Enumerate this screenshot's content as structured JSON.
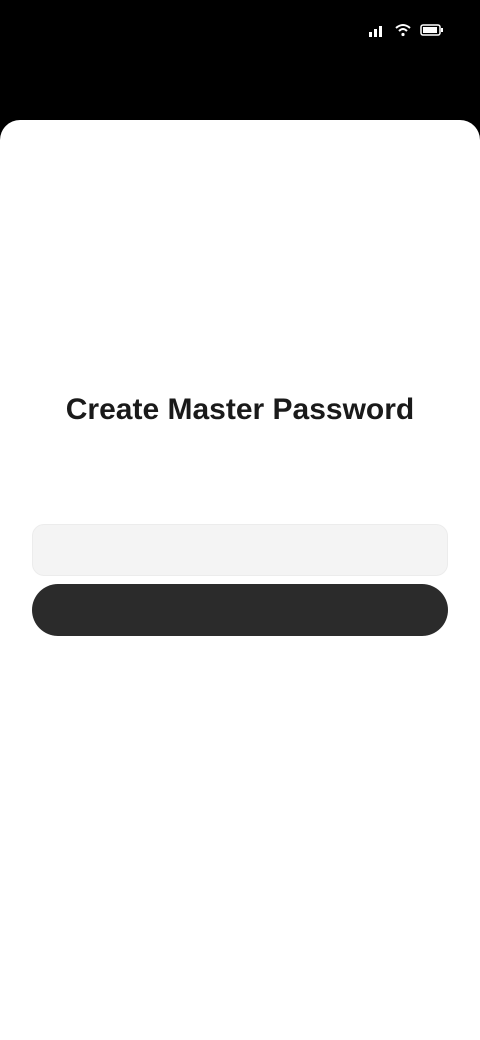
{
  "status_bar": {
    "time": "",
    "icons": [
      "signal-icon",
      "wifi-icon",
      "battery-icon"
    ]
  },
  "screen": {
    "title": "Create Master Password",
    "subtitle": "",
    "hint": {
      "text": "",
      "link": ""
    },
    "password_field": {
      "placeholder": "",
      "value": ""
    },
    "continue_button": {
      "label": ""
    }
  },
  "colors": {
    "background": "#000000",
    "sheet": "#ffffff",
    "title": "#1a1a1a",
    "subtitle": "#8a8a8a",
    "button": "#2b2b2b",
    "button_text": "#ffffff"
  }
}
